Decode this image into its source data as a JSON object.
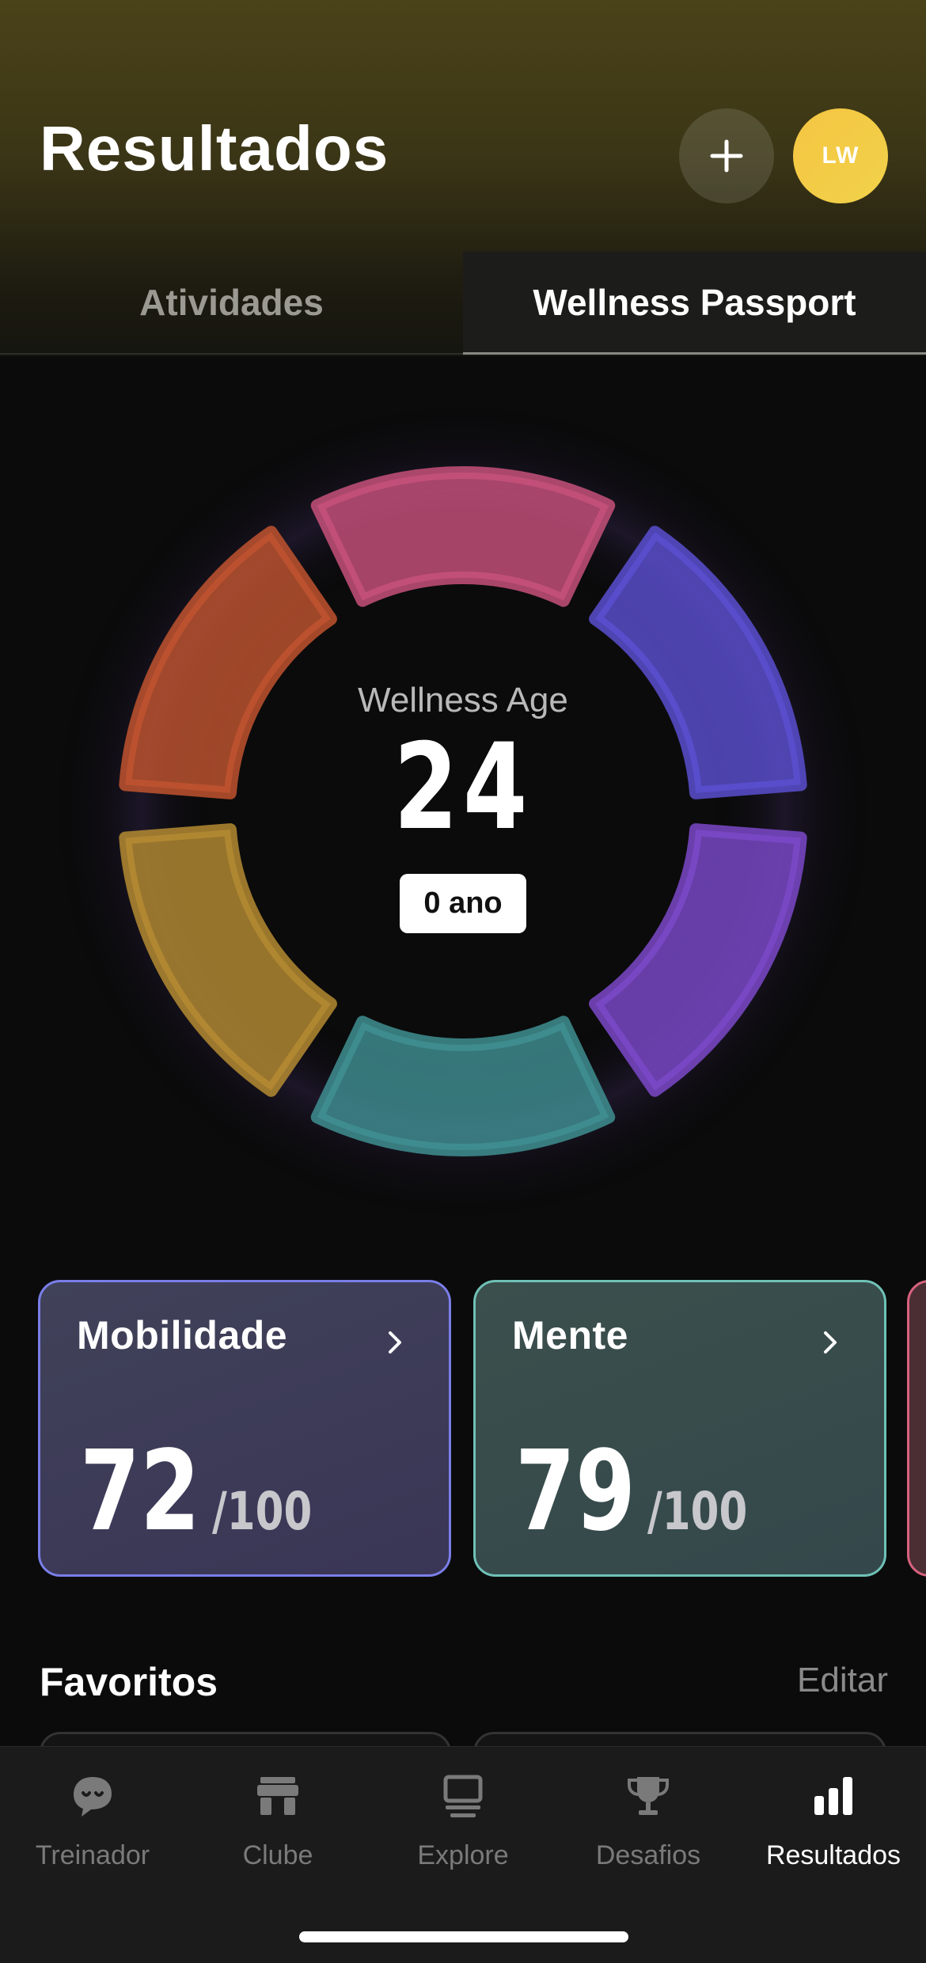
{
  "header": {
    "title": "Resultados",
    "add_icon": "plus-icon",
    "avatar_initials": "LW"
  },
  "tabs": [
    {
      "label": "Atividades",
      "active": false
    },
    {
      "label": "Wellness Passport",
      "active": true
    }
  ],
  "wellness": {
    "label": "Wellness Age",
    "value": "24",
    "delta": "0 ano",
    "ring_segment_colors": [
      "#c7517a",
      "#5b4fd0",
      "#7b49c9",
      "#3f8f92",
      "#b58b32",
      "#c0542f"
    ]
  },
  "scores": [
    {
      "title": "Mobilidade",
      "score": "72",
      "max": "/100",
      "accent": "#7a7ee8"
    },
    {
      "title": "Mente",
      "score": "79",
      "max": "/100",
      "accent": "#6fc1b6"
    }
  ],
  "favorites": {
    "title": "Favoritos",
    "edit_label": "Editar"
  },
  "nav": [
    {
      "label": "Treinador",
      "icon": "coach-icon",
      "active": false
    },
    {
      "label": "Clube",
      "icon": "store-icon",
      "active": false
    },
    {
      "label": "Explore",
      "icon": "explore-icon",
      "active": false
    },
    {
      "label": "Desafios",
      "icon": "trophy-icon",
      "active": false
    },
    {
      "label": "Resultados",
      "icon": "bar-chart-icon",
      "active": true
    }
  ]
}
